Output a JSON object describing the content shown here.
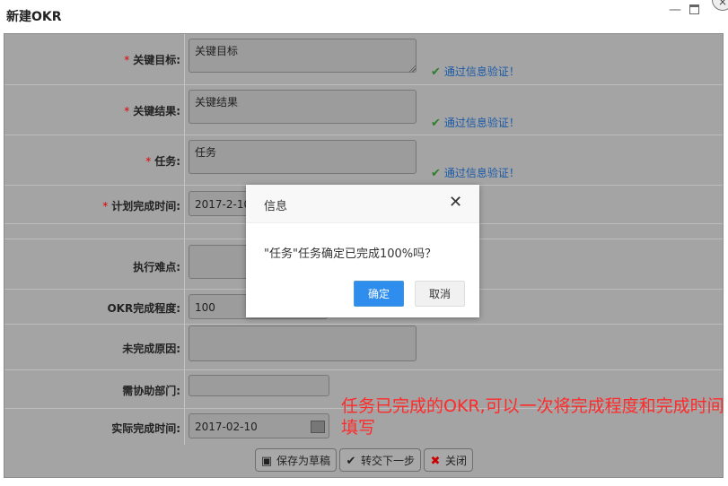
{
  "window": {
    "title": "新建OKR",
    "min_glyph": "—",
    "close_glyph": "×"
  },
  "form": {
    "required_mark": "*",
    "valid_text": "通过信息验证！",
    "fields": {
      "key_objective": {
        "label": "关键目标:",
        "value": "关键目标"
      },
      "key_result": {
        "label": "关键结果:",
        "value": "关键结果"
      },
      "task": {
        "label": "任务:",
        "value": "任务"
      },
      "plan_time": {
        "label": "计划完成时间:",
        "value": "2017-2-10"
      },
      "difficulty": {
        "label": "执行难点:",
        "value": ""
      },
      "completion": {
        "label": "OKR完成程度:",
        "value": "100"
      },
      "reason": {
        "label": "未完成原因:",
        "value": ""
      },
      "dept": {
        "label": "需协助部门:",
        "value": ""
      },
      "actual_time": {
        "label": "实际完成时间:",
        "value": "2017-02-10"
      }
    }
  },
  "buttons": {
    "save_draft": "保存为草稿",
    "next_step": "转交下一步",
    "close": "关闭"
  },
  "icons": {
    "check": "check-icon",
    "calendar": "calendar-icon",
    "save": "save-icon",
    "close": "x-icon"
  },
  "annotation": "任务已完成的OKR,可以一次将完成程度和完成时间填写",
  "dialog": {
    "title": "信息",
    "message": "\"任务\"任务确定已完成100%吗？",
    "ok": "确定",
    "cancel": "取消"
  },
  "colors": {
    "accent": "#2e8ded",
    "annotation": "#ff2a2a",
    "valid": "#1a5aa8",
    "required": "#e00000"
  }
}
